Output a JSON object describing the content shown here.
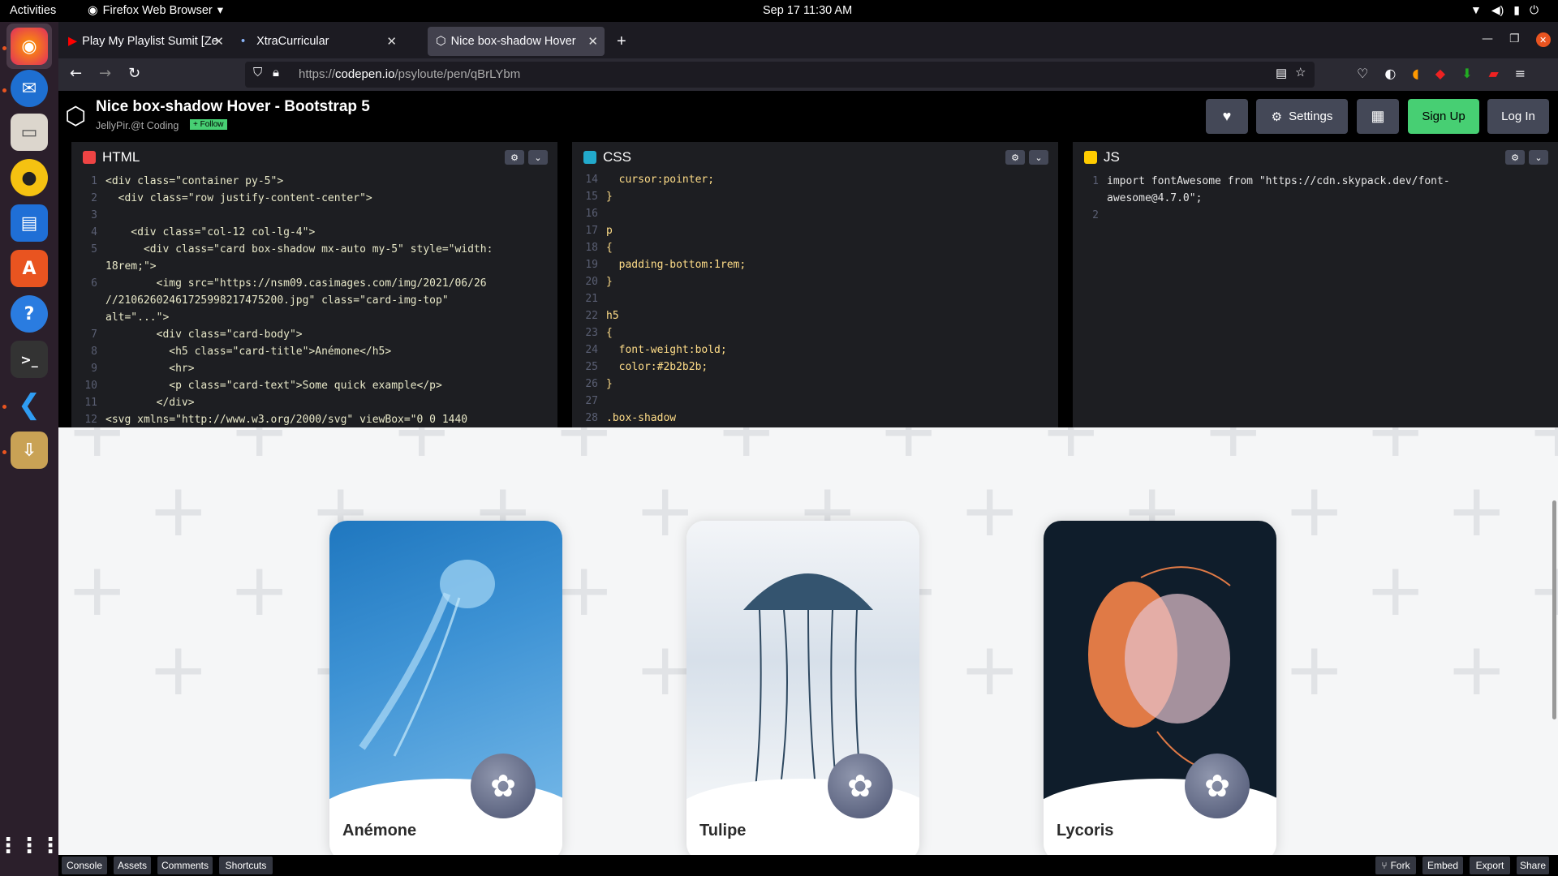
{
  "topbar": {
    "activities": "Activities",
    "app_name": "Firefox Web Browser",
    "clock": "Sep 17  11:30 AM"
  },
  "tabs": [
    {
      "label": "Play My Playlist Sumit [Ze",
      "icon": "youtube-icon"
    },
    {
      "label": "XtraCurricular",
      "icon": "dot-icon"
    },
    {
      "label": "Nice box-shadow Hover",
      "icon": "codepen-icon"
    }
  ],
  "url": {
    "prefix": "https://",
    "domain": "codepen.io",
    "path": "/psyloute/pen/qBrLYbm"
  },
  "codepen": {
    "title": "Nice box-shadow Hover - Bootstrap 5",
    "author": "JellyPir.@t Coding",
    "follow": "+ Follow",
    "settings": "Settings",
    "signup": "Sign Up",
    "login": "Log In"
  },
  "editors": {
    "html": {
      "label": "HTML",
      "lines": [
        {
          "n": "1",
          "t": "<div class=\"container py-5\">"
        },
        {
          "n": "2",
          "t": "  <div class=\"row justify-content-center\">"
        },
        {
          "n": "3",
          "t": ""
        },
        {
          "n": "4",
          "t": "    <div class=\"col-12 col-lg-4\">"
        },
        {
          "n": "5",
          "t": "      <div class=\"card box-shadow mx-auto my-5\" style=\"width:"
        },
        {
          "n": "",
          "t": "18rem;\">"
        },
        {
          "n": "6",
          "t": "        <img src=\"https://nsm09.casimages.com/img/2021/06/26"
        },
        {
          "n": "",
          "t": "//21062602461725998217475200.jpg\" class=\"card-img-top\""
        },
        {
          "n": "",
          "t": "alt=\"...\">"
        },
        {
          "n": "7",
          "t": "        <div class=\"card-body\">"
        },
        {
          "n": "8",
          "t": "          <h5 class=\"card-title\">Anémone</h5>"
        },
        {
          "n": "9",
          "t": "          <hr>"
        },
        {
          "n": "10",
          "t": "          <p class=\"card-text\">Some quick example</p>"
        },
        {
          "n": "11",
          "t": "        </div>"
        },
        {
          "n": "12",
          "t": "<svg xmlns=\"http://www.w3.org/2000/svg\" viewBox=\"0 0 1440"
        }
      ]
    },
    "css": {
      "label": "CSS",
      "lines": [
        {
          "n": "14",
          "t": "  cursor:pointer;"
        },
        {
          "n": "15",
          "t": "}"
        },
        {
          "n": "16",
          "t": ""
        },
        {
          "n": "17",
          "t": "p"
        },
        {
          "n": "18",
          "t": "{"
        },
        {
          "n": "19",
          "t": "  padding-bottom:1rem;"
        },
        {
          "n": "20",
          "t": "}"
        },
        {
          "n": "21",
          "t": ""
        },
        {
          "n": "22",
          "t": "h5"
        },
        {
          "n": "23",
          "t": "{"
        },
        {
          "n": "24",
          "t": "  font-weight:bold;"
        },
        {
          "n": "25",
          "t": "  color:#2b2b2b;"
        },
        {
          "n": "26",
          "t": "}"
        },
        {
          "n": "27",
          "t": ""
        },
        {
          "n": "28",
          "t": ".box-shadow"
        }
      ]
    },
    "js": {
      "label": "JS",
      "lines": [
        {
          "n": "1",
          "t": "import fontAwesome from \"https://cdn.skypack.dev/font-"
        },
        {
          "n": "",
          "t": "awesome@4.7.0\";"
        },
        {
          "n": "2",
          "t": ""
        }
      ]
    }
  },
  "cards": [
    {
      "title": "Anémone",
      "colors": [
        "#1a6fb0",
        "#3d8fd0",
        "#6ab0e6"
      ]
    },
    {
      "title": "Tulipe",
      "colors": [
        "#dfe6ee",
        "#9fb3c8",
        "#f0f3f7"
      ]
    },
    {
      "title": "Lycoris",
      "colors": [
        "#0d1b2a",
        "#1b2838",
        "#e07a46"
      ]
    }
  ],
  "footer": {
    "left": [
      "Console",
      "Assets",
      "Comments",
      "Shortcuts"
    ],
    "right": [
      "Fork",
      "Embed",
      "Export",
      "Share"
    ]
  }
}
